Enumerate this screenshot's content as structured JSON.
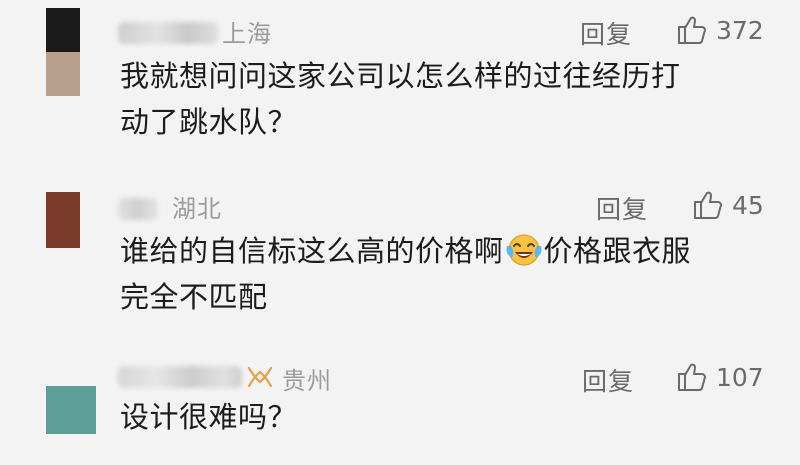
{
  "comments": [
    {
      "location": "上海",
      "reply_label": "回复",
      "like_count": "372",
      "text_lines": [
        "我就想问问这家公司以怎么样的过往经历打",
        "动了跳水队？"
      ],
      "avatar_colors": [
        "#1a1a1a",
        "#b9a08d"
      ]
    },
    {
      "location": "湖北",
      "reply_label": "回复",
      "like_count": "45",
      "text_before_emoji": "谁给的自信标这么高的价格啊",
      "emoji": "crying-laughing-emoji",
      "text_after_emoji": "价格跟衣服",
      "text_line2": "完全不匹配",
      "avatar_colors": [
        "#7a3a2a",
        "#7a3a2a"
      ]
    },
    {
      "location": "贵州",
      "reply_label": "回复",
      "like_count": "107",
      "text_lines": [
        "设计很难吗？"
      ],
      "avatar_colors": [
        "#5e9e98",
        "#5e9e98"
      ]
    }
  ],
  "colors": {
    "background": "#f3f3f3",
    "secondary_text": "#6a6a6a",
    "location_text": "#9b9b9b",
    "badge_accent": "#e4a34a"
  }
}
